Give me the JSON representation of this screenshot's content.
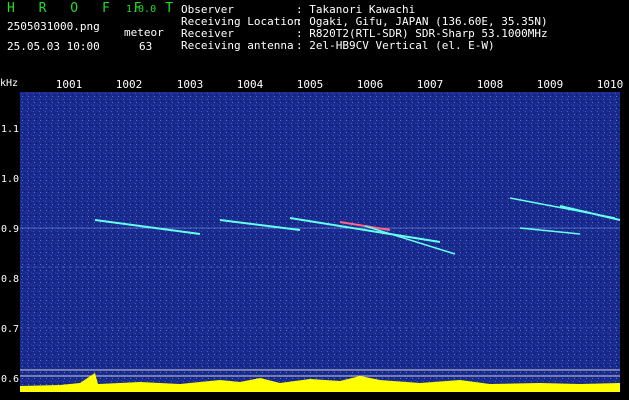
{
  "app": {
    "logo": "H R O F F T",
    "version": "1.0.0",
    "filename": "2505031000.png",
    "datetime": "25.05.03 10:00",
    "meteor_label": "meteor",
    "meteor_count": "63"
  },
  "info": [
    {
      "label": "Observer",
      "value": ": Takanori Kawachi"
    },
    {
      "label": "Receiving Location",
      "value": ": Ogaki, Gifu, JAPAN (136.60E, 35.35N)"
    },
    {
      "label": "Receiver",
      "value": ": R820T2(RTL-SDR) SDR-Sharp 53.1000MHz"
    },
    {
      "label": "Receiving antenna",
      "value": ": 2el-HB9CV Vertical (el. E-W)"
    }
  ],
  "axis": {
    "unit": "kHz",
    "time_ticks": [
      "1001",
      "1002",
      "1003",
      "1004",
      "1005",
      "1006",
      "1007",
      "1008",
      "1009",
      "1010"
    ],
    "freq_ticks": [
      "1.1",
      "1.0",
      "0.9",
      "0.8",
      "0.7",
      "0.6"
    ]
  },
  "colors": {
    "background": "#000000",
    "spectrogram_bg": "#1a2a8c",
    "header_green": "#22dd22",
    "trace_cyan": "#66ffee",
    "power_yellow": "#ffff00"
  }
}
